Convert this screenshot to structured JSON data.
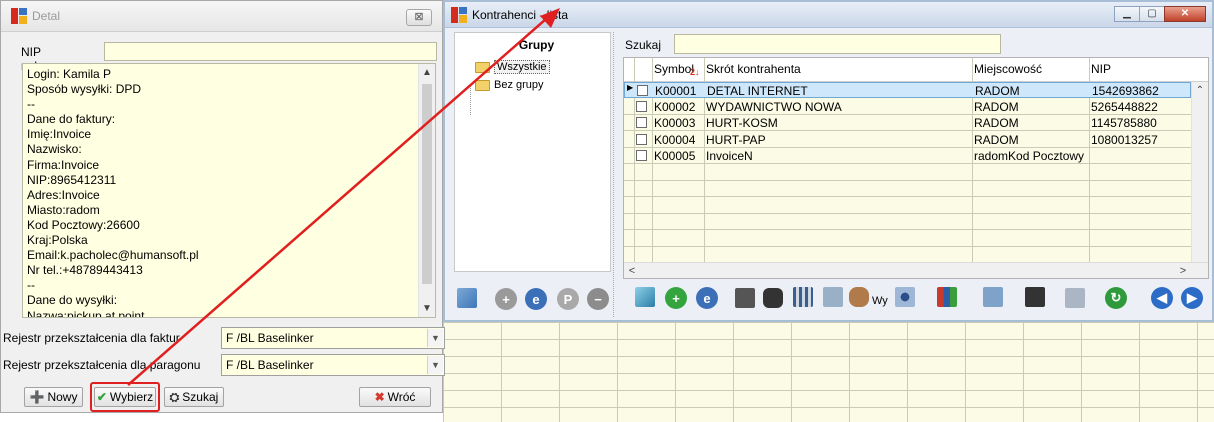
{
  "detal": {
    "title": "Detal",
    "close_symbol": "⊠",
    "nip_label": "NIP nabywcy",
    "nip_value": "",
    "memo_lines": [
      "Login: Kamila P",
      "Sposób wysyłki: DPD",
      "--",
      "Dane do faktury:",
      "Imię:Invoice",
      "Nazwisko:",
      "Firma:Invoice",
      "NIP:8965412311",
      "Adres:Invoice",
      "Miasto:radom",
      "Kod Pocztowy:26600",
      "Kraj:Polska",
      "Email:k.pacholec@humansoft.pl",
      "Nr tel.:+48789443413",
      "--",
      "Dane do wysyłki:",
      "Nazwa:pickup at point"
    ],
    "registers": [
      {
        "label": "Rejestr przekształcenia dla faktur",
        "value": "F /BL Baselinker"
      },
      {
        "label": "Rejestr przekształcenia dla paragonu",
        "value": "F /BL Baselinker"
      }
    ],
    "buttons": {
      "new": "Nowy",
      "select": "Wybierz",
      "search": "Szukaj",
      "back": "Wróć"
    }
  },
  "kontrahenci": {
    "title": "Kontrahenci - lista",
    "groups_header": "Grupy",
    "groups": [
      "Wszystkie",
      "Bez grupy"
    ],
    "search_label": "Szukaj",
    "search_value": "",
    "columns": [
      "Symbol",
      "Skrót kontrahenta",
      "Miejscowość",
      "NIP"
    ],
    "sort_indicator": "2↓",
    "rows": [
      {
        "symbol": "K00001",
        "name": "DETAL INTERNET",
        "city": "RADOM",
        "nip": "1542693862"
      },
      {
        "symbol": "K00002",
        "name": "WYDAWNICTWO NOWA",
        "city": "RADOM",
        "nip": "5265448822"
      },
      {
        "symbol": "K00003",
        "name": "HURT-KOSM",
        "city": "RADOM",
        "nip": "1145785880"
      },
      {
        "symbol": "K00004",
        "name": "HURT-PAP",
        "city": "RADOM",
        "nip": "1080013257"
      },
      {
        "symbol": "K00005",
        "name": "InvoiceN",
        "city": "radomKod Pocztowy",
        "nip": ""
      }
    ],
    "toolbar_text": "Wy",
    "colors": {
      "selected_row": "#cfe7fb",
      "grid_bg": "#fbfbe6",
      "arrow": "#e02020",
      "highlight": "#e02020"
    }
  }
}
